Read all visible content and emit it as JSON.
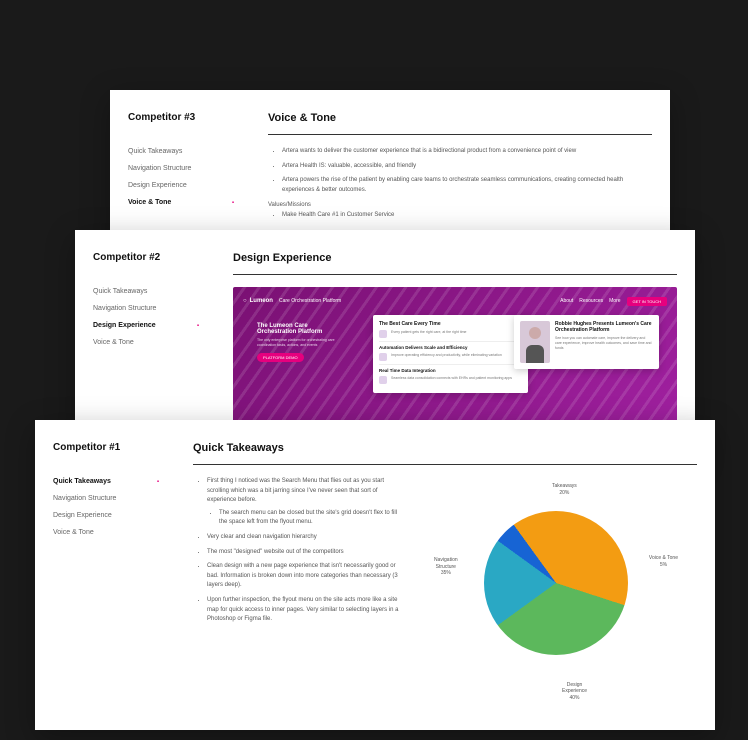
{
  "card3": {
    "sidebar_title": "Competitor #3",
    "nav": [
      "Quick Takeaways",
      "Navigation Structure",
      "Design Experience",
      "Voice & Tone"
    ],
    "active_index": 3,
    "heading": "Voice & Tone",
    "bullets": [
      "Artera wants to deliver the customer experience that is a bidirectional product from a convenience point of view",
      "Artera Health IS: valuable, accessible, and friendly",
      "Artera powers the rise of the patient by enabling care teams to orchestrate seamless communications, creating connected health experiences & better outcomes."
    ],
    "vm_label": "Values/Missions",
    "vm_item": "Make Health Care #1 in Customer Service"
  },
  "card2": {
    "sidebar_title": "Competitor #2",
    "nav": [
      "Quick Takeaways",
      "Navigation Structure",
      "Design Experience",
      "Voice & Tone"
    ],
    "active_index": 2,
    "heading": "Design Experience",
    "img": {
      "brand": "Lumeon",
      "nav_items": [
        "Care Orchestration Platform",
        "About",
        "Resources",
        "More"
      ],
      "cta": "GET IN TOUCH",
      "p1_title": "The Lumeon Care Orchestration Platform",
      "p1_sub": "The only enterprise platform for orchestrating care coordination tasks, actions, and events",
      "p1_btn": "PLATFORM DEMO",
      "p2_title": "The Best Care Every Time",
      "p2_line1": "Every patient gets the right care, at the right time",
      "p2_sub_title": "Automation Delivers Scale and Efficiency",
      "p2_sub_line": "Improve operating efficiency and productivity, while eliminating variation",
      "p2_sub2_title": "Real Time Data Integration",
      "p2_sub2_line": "Seamless data consolidation connects with EHRs and patient monitoring apps",
      "p3_title": "Robbie Hughes Presents Lumeon's Care Orchestration Platform",
      "p3_line": "See how you can automate care, improve the delivery and care experience, improve health outcomes, and save time and funds"
    }
  },
  "card1": {
    "sidebar_title": "Competitor #1",
    "nav": [
      "Quick Takeaways",
      "Navigation Structure",
      "Design Experience",
      "Voice & Tone"
    ],
    "active_index": 0,
    "heading": "Quick Takeaways",
    "bullets": [
      {
        "text": "First thing I noticed was the Search Menu that flies out as you start scrolling which was a bit jarring since I've never seen that sort of experience before.",
        "sub": [
          "The search menu can be closed but the site's grid doesn't flex to fill the space left from the flyout menu."
        ]
      },
      {
        "text": "Very clear and clean navigation hierarchy"
      },
      {
        "text": "The most \"designed\" website out of the competitors"
      },
      {
        "text": "Clean design with a new page experience that isn't necessarily good or bad. Information is broken down into more categories than necessary (3 layers deep)."
      },
      {
        "text": "Upon further inspection, the flyout menu on the site acts more like a site map for quick access to inner pages. Very similar to selecting layers in a Photoshop or Figma file."
      }
    ]
  },
  "chart_data": {
    "type": "pie",
    "title": "",
    "series": [
      {
        "name": "Takeaways",
        "value": 20,
        "color": "#2aa8c4"
      },
      {
        "name": "Voice & Tone",
        "value": 5,
        "color": "#1764d4"
      },
      {
        "name": "Design Experience",
        "value": 40,
        "color": "#f39c12"
      },
      {
        "name": "Navigation Structure",
        "value": 35,
        "color": "#5cb85c"
      }
    ],
    "labels": {
      "takeaways": "Takeaways\n20%",
      "voice": "Voice & Tone\n5%",
      "design": "Design\nExperience\n40%",
      "nav": "Navigation\nStructure\n35%"
    }
  }
}
